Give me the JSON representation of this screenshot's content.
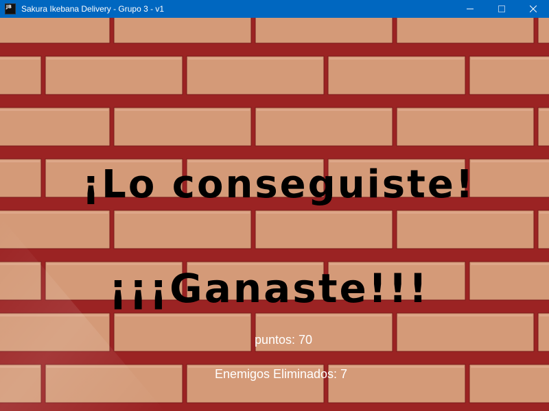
{
  "window": {
    "title": "Sakura Ikebana Delivery - Grupo 3 - v1",
    "app_icon_text": "JB",
    "titlebar_color": "#0067c0",
    "controls": [
      "minimize-icon",
      "maximize-icon",
      "close-icon"
    ]
  },
  "scene": {
    "background": "brick-wall",
    "brick_color": "#d49a78",
    "mortar_color": "#9b2323",
    "headline": "¡Lo conseguiste!",
    "subheadline": "¡¡¡Ganaste!!!",
    "points_label": "puntos: 70",
    "enemies_label": "Enemigos Eliminados: 7"
  }
}
